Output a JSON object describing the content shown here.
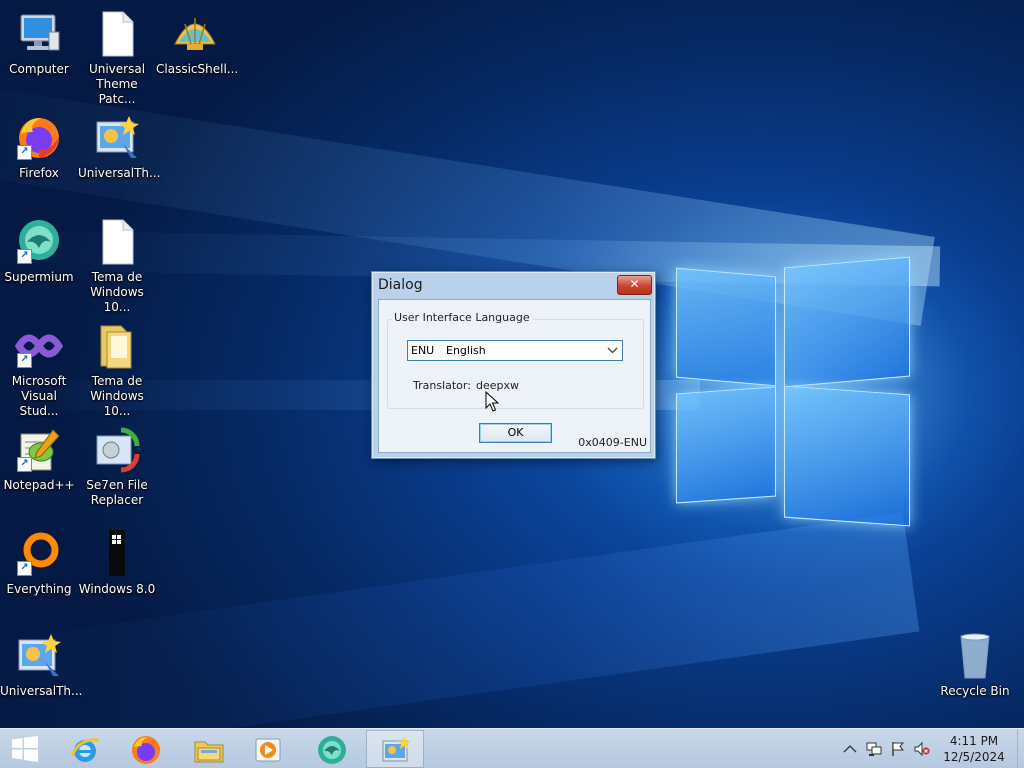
{
  "desktop": {
    "icons": [
      {
        "label": "Computer",
        "icon": "computer-icon"
      },
      {
        "label": "Universal Theme Patc...",
        "icon": "document-icon"
      },
      {
        "label": "ClassicShell...",
        "icon": "classic-shell-icon"
      },
      {
        "label": "Firefox",
        "icon": "firefox-icon"
      },
      {
        "label": "UniversalTh...",
        "icon": "universal-theme-icon"
      },
      {
        "label": "Supermium",
        "icon": "supermium-icon"
      },
      {
        "label": "Tema de Windows 10...",
        "icon": "document-icon"
      },
      {
        "label": "Microsoft Visual Stud...",
        "icon": "visual-studio-icon"
      },
      {
        "label": "Tema de Windows 10...",
        "icon": "folder-icon"
      },
      {
        "label": "Notepad++",
        "icon": "notepad-plus-plus-icon"
      },
      {
        "label": "Se7en File Replacer",
        "icon": "se7en-file-replacer-icon"
      },
      {
        "label": "Everything",
        "icon": "everything-search-icon"
      },
      {
        "label": "Windows 8.0",
        "icon": "windows-8-icon"
      },
      {
        "label": "UniversalTh...",
        "icon": "universal-theme-icon"
      },
      {
        "label": "Recycle Bin",
        "icon": "recycle-bin-icon"
      }
    ]
  },
  "dialog": {
    "title": "Dialog",
    "close_label": "✕",
    "group_title": "User Interface Language",
    "language_code": "ENU",
    "language_name": "English",
    "translator_label": "Translator:",
    "translator_value": "deepxw",
    "ok_label": "OK",
    "locale_code": "0x0409-ENU"
  },
  "taskbar": {
    "start_icon": "windows-start-icon",
    "pinned": [
      {
        "name": "internet-explorer",
        "icon": "internet-explorer-icon"
      },
      {
        "name": "firefox",
        "icon": "firefox-icon"
      },
      {
        "name": "file-explorer",
        "icon": "file-explorer-icon"
      },
      {
        "name": "media-player",
        "icon": "media-player-icon"
      },
      {
        "name": "supermium",
        "icon": "supermium-icon"
      },
      {
        "name": "universal-theme-patcher",
        "icon": "universal-theme-icon",
        "active": true
      }
    ],
    "tray": [
      "chevron-up-icon",
      "network-icon",
      "flag-icon",
      "volume-muted-icon"
    ],
    "time": "4:11 PM",
    "date": "12/5/2024"
  }
}
